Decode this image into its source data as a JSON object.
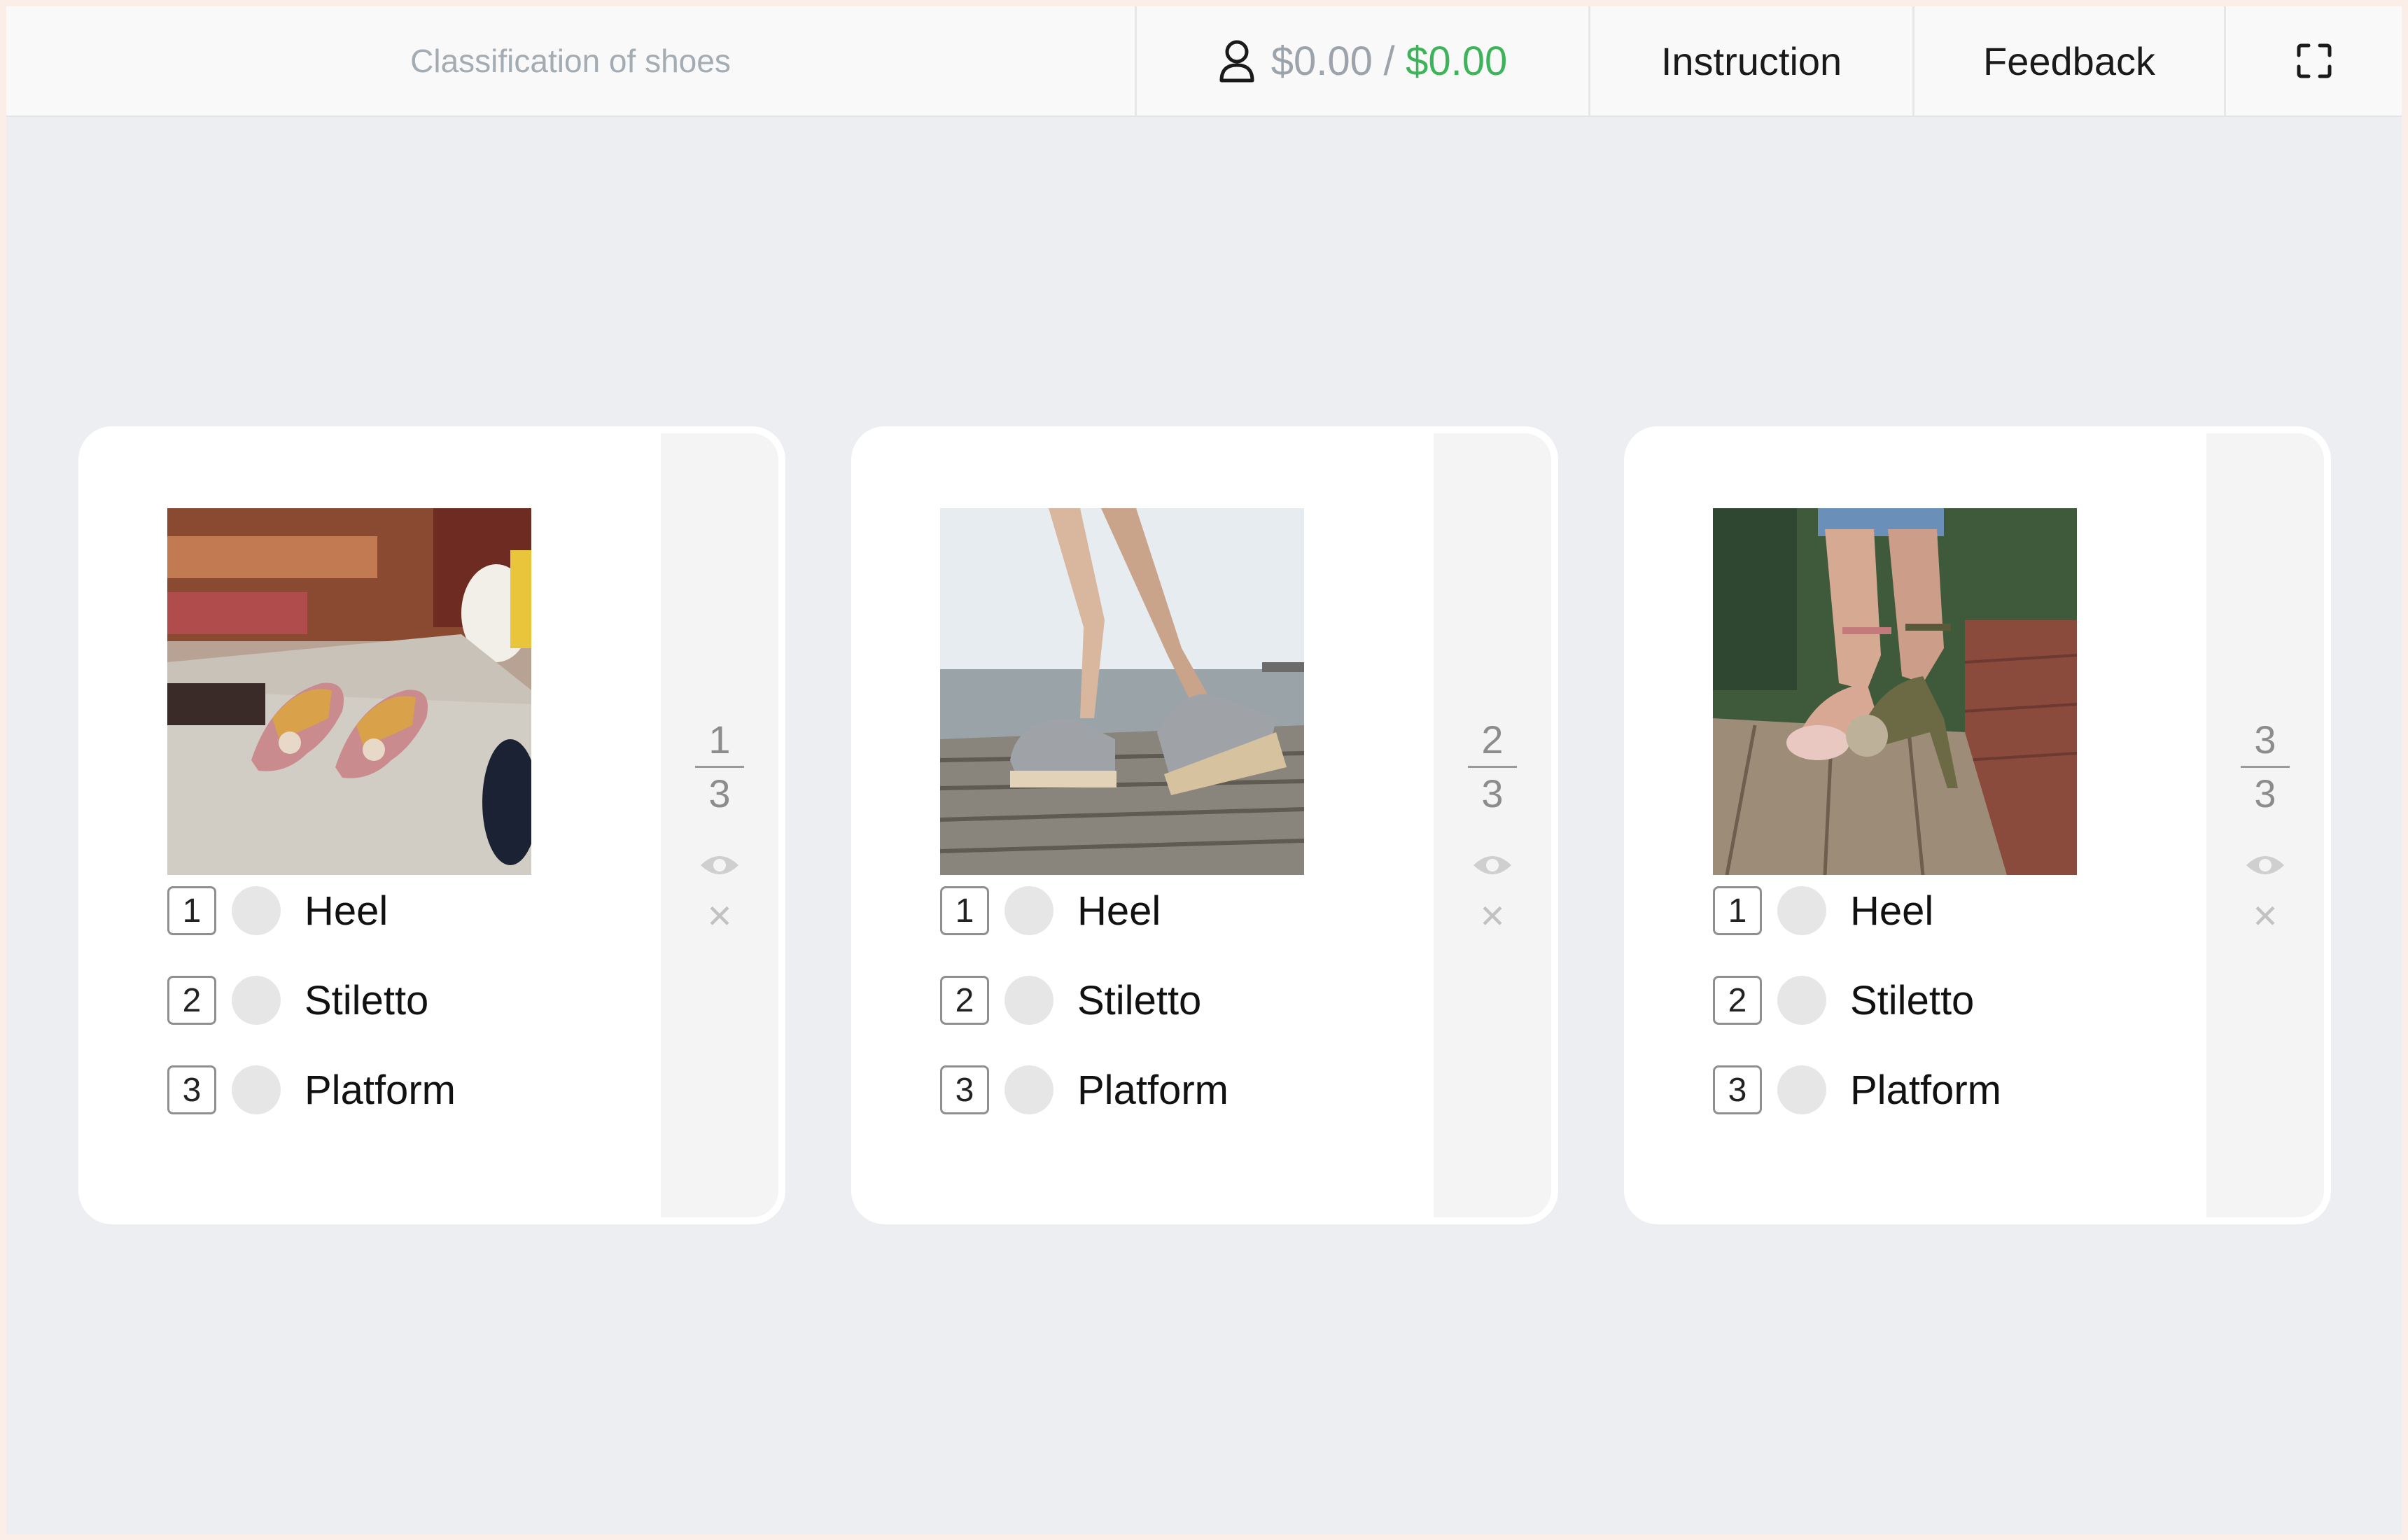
{
  "header": {
    "title": "Classification of shoes",
    "balance_current": "$0.00",
    "balance_separator": "/",
    "balance_total": "$0.00",
    "instruction_label": "Instruction",
    "feedback_label": "Feedback",
    "colors": {
      "balance_total": "#3db35a",
      "title": "#a3abb3"
    }
  },
  "tasks": [
    {
      "index": "1",
      "total": "3",
      "image_subject": "pink satin slingback heels with jeweled straps",
      "options": [
        {
          "key": "1",
          "label": "Heel"
        },
        {
          "key": "2",
          "label": "Stiletto"
        },
        {
          "key": "3",
          "label": "Platform"
        }
      ]
    },
    {
      "index": "2",
      "total": "3",
      "image_subject": "metallic platform sandals walking on wooden pier",
      "options": [
        {
          "key": "1",
          "label": "Heel"
        },
        {
          "key": "2",
          "label": "Stiletto"
        },
        {
          "key": "3",
          "label": "Platform"
        }
      ]
    },
    {
      "index": "3",
      "total": "3",
      "image_subject": "ankle-strap stiletto heels with fur on wooden deck",
      "options": [
        {
          "key": "1",
          "label": "Heel"
        },
        {
          "key": "2",
          "label": "Stiletto"
        },
        {
          "key": "3",
          "label": "Platform"
        }
      ]
    }
  ]
}
